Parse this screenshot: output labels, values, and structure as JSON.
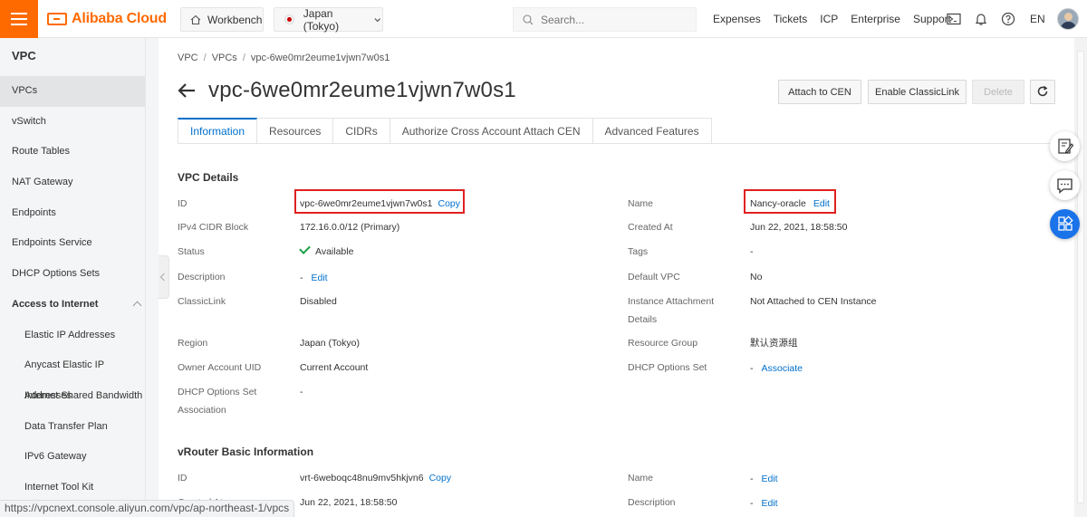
{
  "topbar": {
    "brand": "Alibaba Cloud",
    "workbench": "Workbench",
    "region": "Japan (Tokyo)",
    "search_placeholder": "Search...",
    "links": [
      "Expenses",
      "Tickets",
      "ICP",
      "Enterprise",
      "Support"
    ],
    "lang": "EN",
    "accent": "#ff6a00"
  },
  "sidebar": {
    "title": "VPC",
    "items": [
      {
        "label": "VPCs"
      },
      {
        "label": "vSwitch"
      },
      {
        "label": "Route Tables"
      },
      {
        "label": "NAT Gateway"
      },
      {
        "label": "Endpoints"
      },
      {
        "label": "Endpoints Service"
      },
      {
        "label": "DHCP Options Sets"
      },
      {
        "label": "Access to Internet"
      },
      {
        "label": "Elastic IP Addresses"
      },
      {
        "label": "Anycast Elastic IP Addresses"
      },
      {
        "label": "Internet Shared Bandwidth"
      },
      {
        "label": "Data Transfer Plan"
      },
      {
        "label": "IPv6 Gateway"
      },
      {
        "label": "Internet Tool Kit"
      }
    ]
  },
  "breadcrumb": [
    "VPC",
    "VPCs",
    "vpc-6we0mr2eume1vjwn7w0s1"
  ],
  "page": {
    "title": "vpc-6we0mr2eume1vjwn7w0s1",
    "buttons": {
      "attach_cen": "Attach to CEN",
      "enable_classiclink": "Enable ClassicLink",
      "delete": "Delete"
    }
  },
  "tabs": [
    "Information",
    "Resources",
    "CIDRs",
    "Authorize Cross Account Attach CEN",
    "Advanced Features"
  ],
  "vpc_details": {
    "title": "VPC Details",
    "id_label": "ID",
    "id_value": "vpc-6we0mr2eume1vjwn7w0s1",
    "copy": "Copy",
    "name_label": "Name",
    "name_value": "Nancy-oracle",
    "edit": "Edit",
    "cidr_label": "IPv4 CIDR Block",
    "cidr_value": "172.16.0.0/12 (Primary)",
    "created_label": "Created At",
    "created_value": "Jun 22, 2021, 18:58:50",
    "status_label": "Status",
    "status_value": "Available",
    "tags_label": "Tags",
    "tags_value": "-",
    "desc_label": "Description",
    "desc_value": "-",
    "default_vpc_label": "Default VPC",
    "default_vpc_value": "No",
    "classiclink_label": "ClassicLink",
    "classiclink_value": "Disabled",
    "attach_label_1": "Instance Attachment",
    "attach_label_2": "Details",
    "attach_value": "Not Attached to CEN Instance",
    "region_label": "Region",
    "region_value": "Japan (Tokyo)",
    "rg_label": "Resource Group",
    "rg_value": "默认资源组",
    "owner_label": "Owner Account UID",
    "owner_value": "Current Account",
    "dhcp_label": "DHCP Options Set",
    "dhcp_value": "-",
    "associate": "Associate",
    "dhcp_assoc_label_1": "DHCP Options Set",
    "dhcp_assoc_label_2": "Association",
    "dhcp_assoc_value": "-"
  },
  "vrouter": {
    "title": "vRouter Basic Information",
    "id_label": "ID",
    "id_value": "vrt-6weboqc48nu9mv5hkjvn6",
    "copy": "Copy",
    "name_label": "Name",
    "name_value": "-",
    "edit": "Edit",
    "created_label": "Created At",
    "created_value": "Jun 22, 2021, 18:58:50",
    "desc_label": "Description",
    "desc_value": "-"
  },
  "status_url": "https://vpcnext.console.aliyun.com/vpc/ap-northeast-1/vpcs"
}
